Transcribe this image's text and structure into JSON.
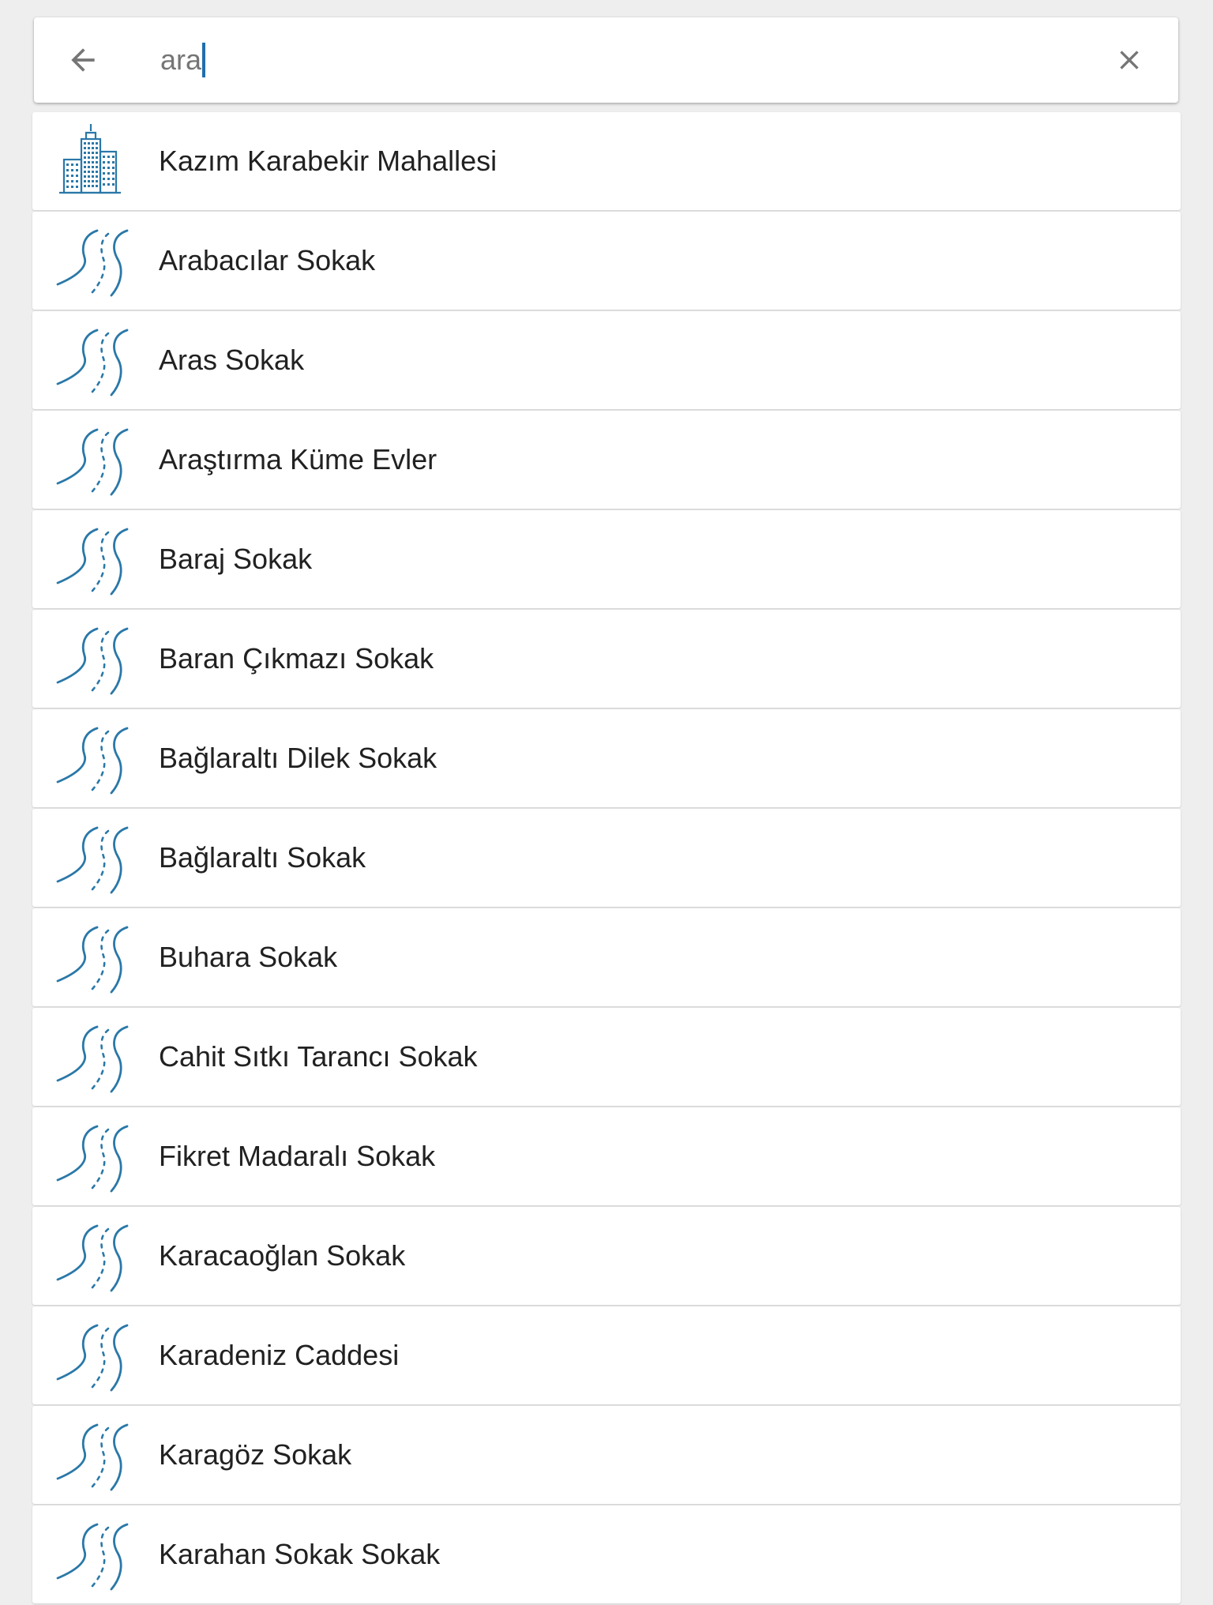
{
  "search": {
    "query": "ara"
  },
  "colors": {
    "accent": "#1f6fae",
    "icon_blue": "#2a78a8"
  },
  "results": [
    {
      "label": "Kazım Karabekir Mahallesi",
      "icon": "building-icon"
    },
    {
      "label": "Arabacılar Sokak",
      "icon": "road-icon"
    },
    {
      "label": "Aras Sokak",
      "icon": "road-icon"
    },
    {
      "label": "Araştırma Küme Evler",
      "icon": "road-icon"
    },
    {
      "label": "Baraj Sokak",
      "icon": "road-icon"
    },
    {
      "label": "Baran Çıkmazı Sokak",
      "icon": "road-icon"
    },
    {
      "label": "Bağlaraltı Dilek Sokak",
      "icon": "road-icon"
    },
    {
      "label": "Bağlaraltı Sokak",
      "icon": "road-icon"
    },
    {
      "label": "Buhara Sokak",
      "icon": "road-icon"
    },
    {
      "label": "Cahit Sıtkı Tarancı Sokak",
      "icon": "road-icon"
    },
    {
      "label": "Fikret Madaralı Sokak",
      "icon": "road-icon"
    },
    {
      "label": "Karacaoğlan Sokak",
      "icon": "road-icon"
    },
    {
      "label": "Karadeniz Caddesi",
      "icon": "road-icon"
    },
    {
      "label": "Karagöz Sokak",
      "icon": "road-icon"
    },
    {
      "label": "Karahan Sokak Sokak",
      "icon": "road-icon"
    }
  ]
}
